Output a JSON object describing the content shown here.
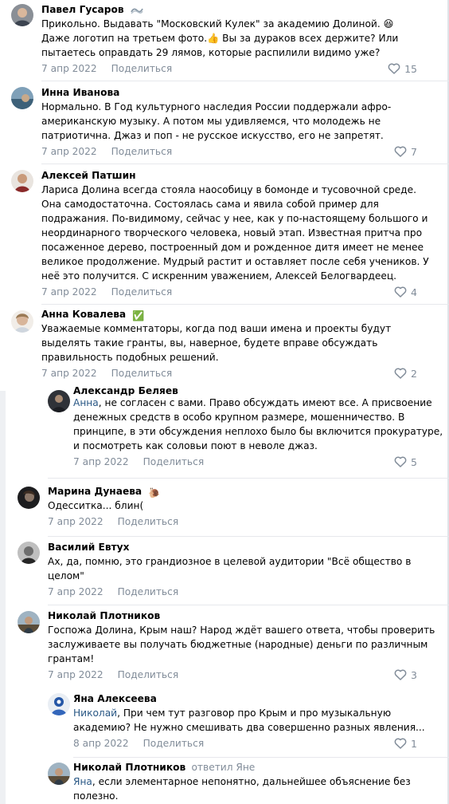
{
  "comments": [
    {
      "author": "Павел Гусаров",
      "badge": "",
      "replied_to": "",
      "mention": "",
      "text": "Прикольно. Выдавать \"Московский Кулек\" за академию Долиной. 😆\nДаже логотип на третьем фото.👍 Вы за дураков всех держите? Или\nпытаетесь оправдать 29 лямов, которые распилили видимо уже?",
      "date": "7 апр 2022",
      "share": "Поделиться",
      "likes": "15"
    },
    {
      "author": "Инна Иванова",
      "badge": "",
      "replied_to": "",
      "mention": "",
      "text": "Нормально. В Год культурного наследия России поддержали афро-\nамериканскую музыку. А потом мы удивляемся, что молодежь не\nпатриотична. Джаз и поп - не русское искусство, его не запретят.",
      "date": "7 апр 2022",
      "share": "Поделиться",
      "likes": "7"
    },
    {
      "author": "Алексей Патшин",
      "badge": "",
      "replied_to": "",
      "mention": "",
      "text": "Лариса Долина всегда стояла наособицу в бомонде и тусовочной среде.\nОна самодостаточна. Состоялась сама и явила собой пример для\nподражания. По-видимому, сейчас у нее, как у по-настоящему большого и\nнеординарного творческого человека, новый этап. Известная притча про\nпосаженное дерево, построенный дом и рожденное дитя имеет не менее\nвеликое продолжение. Мудрый растит и оставляет после себя учеников. У\nнеё это получится. С искренним уважением, Алексей Белогвардеец.",
      "date": "7 апр 2022",
      "share": "Поделиться",
      "likes": "4"
    },
    {
      "author": "Анна Ковалева",
      "badge": "✅",
      "replied_to": "",
      "mention": "",
      "text": "Уважаемые комментаторы, когда под ваши имена и проекты будут\nвыделять такие гранты, вы, наверное, будете вправе обсуждать\nправильность подобных решений.",
      "date": "7 апр 2022",
      "share": "Поделиться",
      "likes": "2"
    },
    {
      "author": "Александр Беляев",
      "badge": "",
      "replied_to": "",
      "mention": "Анна",
      "text": ", не согласен с вами. Право обсуждать имеют все. А присвоение\nденежных средств в особо крупном размере, мошенничество. В\nпринципе, в эти обсуждения неплохо было бы включится прокуратуре,\nи посмотреть как соловьи поют в неволе джаз.",
      "date": "7 апр 2022",
      "share": "Поделиться",
      "likes": "5"
    },
    {
      "author": "Марина Дунаева",
      "badge": "🐌",
      "replied_to": "",
      "mention": "",
      "text": "Одесситка... блин(",
      "date": "7 апр 2022",
      "share": "Поделиться",
      "likes": ""
    },
    {
      "author": "Василий Евтух",
      "badge": "",
      "replied_to": "",
      "mention": "",
      "text": "Ах, да, помню, это грандиозное в целевой аудитории \"Всё общество в\nцелом\"",
      "date": "7 апр 2022",
      "share": "Поделиться",
      "likes": ""
    },
    {
      "author": "Николай Плотников",
      "badge": "",
      "replied_to": "",
      "mention": "",
      "text": "Госпожа Долина, Крым наш? Народ ждёт вашего ответа, чтобы проверить\nзаслуживаете вы получать бюджетные (народные) деньги по различным\nгрантам!",
      "date": "7 апр 2022",
      "share": "Поделиться",
      "likes": "3"
    },
    {
      "author": "Яна Алексеева",
      "badge": "",
      "replied_to": "",
      "mention": "Николай",
      "text": ", При чем тут разговор про Крым и про музыкальную\nакадемию? Не нужно смешивать два совершенно разных явления...",
      "date": "8 апр 2022",
      "share": "Поделиться",
      "likes": "1"
    },
    {
      "author": "Николай Плотников",
      "badge": "",
      "replied_to": "ответил Яне",
      "mention": "Яна",
      "text": ", если элементарное непонятно, дальнейшее объяснение без\nполезно.",
      "date": "",
      "share": "",
      "likes": ""
    }
  ]
}
